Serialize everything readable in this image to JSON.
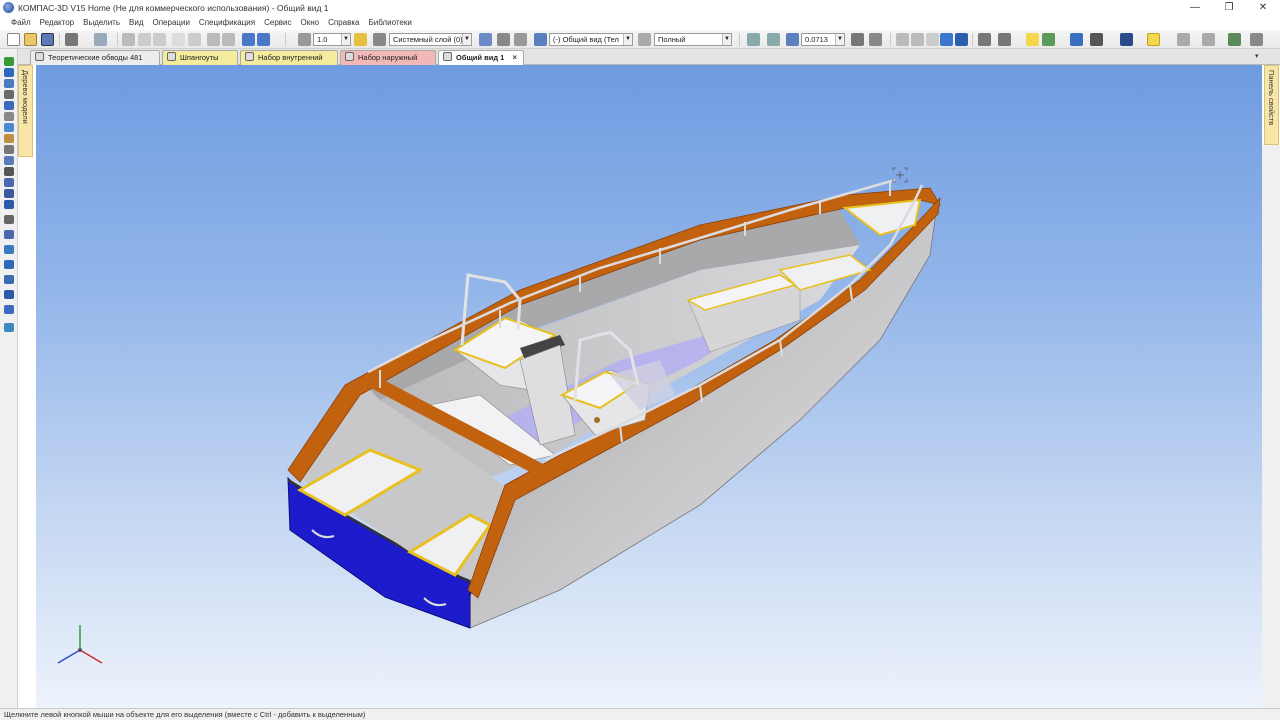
{
  "window": {
    "title": "КОМПАС-3D V15 Home (Не для коммерческого использования) - Общий вид 1",
    "minimize_glyph": "—",
    "maximize_glyph": "❐",
    "close_glyph": "✕"
  },
  "menu": {
    "items": [
      "Файл",
      "Редактор",
      "Выделить",
      "Вид",
      "Операции",
      "Спецификация",
      "Сервис",
      "Окно",
      "Справка",
      "Библиотеки"
    ]
  },
  "toolbar": {
    "scale_value": "1.0",
    "layer_value": "Системный слой (0)",
    "view_value": "(-) Общий вид (Тел",
    "display_value": "Полный",
    "zoom_value": "0.0713"
  },
  "tabs": [
    {
      "label": "Теоретические обводы 481",
      "color": "#ececec"
    },
    {
      "label": "Шпангоуты",
      "color": "#f4ec9c"
    },
    {
      "label": "Набор внутренний",
      "color": "#f4ec9c"
    },
    {
      "label": "Набор наружный",
      "color": "#f2b8b8"
    },
    {
      "label": "Общий вид 1",
      "color": "#ffffff",
      "active": true,
      "close": "×"
    }
  ],
  "tab_dropdown": "▾",
  "side_panels": {
    "model_tree": "Дерево модели",
    "properties": "Панель свойств"
  },
  "status": {
    "hint": "Щелкните левой кнопкой мыши на объекте для его выделения (вместе с Ctrl - добавить к выделенным)"
  },
  "colors": {
    "viewport_top": "#6e9be0",
    "viewport_bottom": "#eef3fc",
    "hull_side": "#b7b7b9",
    "gunwale": "#c2620f",
    "transom": "#1c1ccc",
    "deck": "#ededf0",
    "seat_trim": "#e8c020",
    "floor": "#b5b0f0",
    "rail": "#d8d8dc"
  },
  "icons": [
    "new-document-icon",
    "open-icon",
    "save-icon",
    "print-icon",
    "zoom-icon",
    "rotate-icon",
    "axes-triad-icon",
    "model-tree-icon"
  ]
}
